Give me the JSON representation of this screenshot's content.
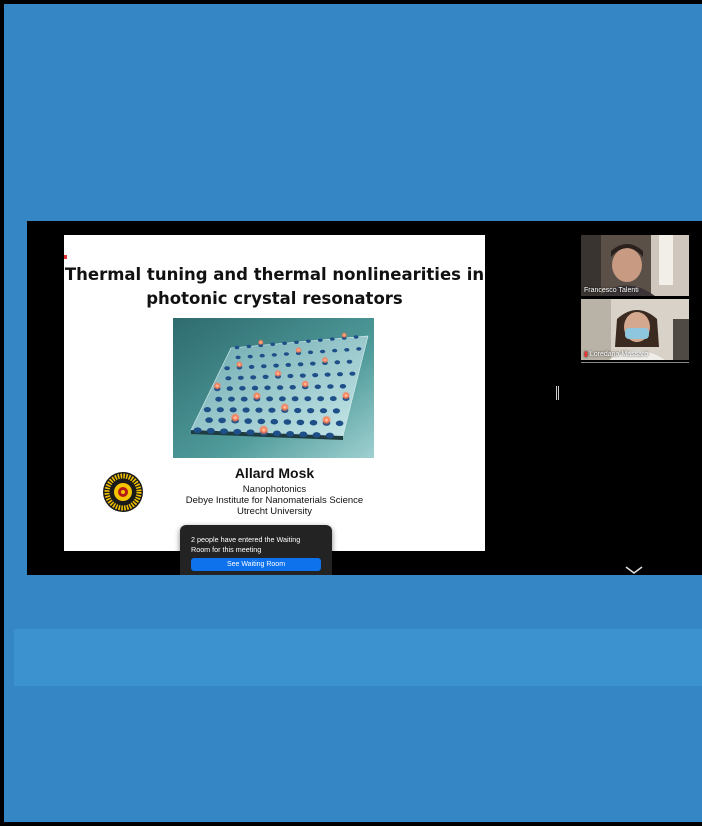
{
  "slide": {
    "title": "Thermal tuning and thermal nonlinearities in\nphotonic crystal resonators",
    "author": "Allard Mosk",
    "group": "Nanophotonics",
    "institute": "Debye Institute for Nanomaterials Science",
    "university": "Utrecht University"
  },
  "participants": [
    {
      "name": "Francesco Talenti",
      "muted": false
    },
    {
      "name": "Loredana Massaro",
      "muted": true
    }
  ],
  "waiting_room_toast": {
    "message": "2 people have entered the Waiting\nRoom for this meeting",
    "button_label": "See Waiting Room"
  },
  "colors": {
    "background": "#3486c4",
    "toast_button": "#0e72ed"
  }
}
